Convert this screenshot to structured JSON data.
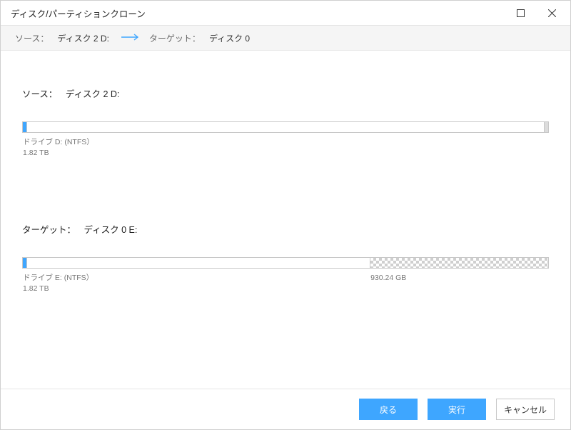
{
  "window": {
    "title": "ディスク/パーティションクローン"
  },
  "summary": {
    "source_label": "ソース：",
    "source_value": "ディスク 2 D:",
    "target_label": "ターゲット：",
    "target_value": "ディスク 0"
  },
  "source_section": {
    "label": "ソース：",
    "value": "ディスク 2 D:",
    "segments": [
      {
        "kind": "used",
        "width_pct": 0.8
      },
      {
        "kind": "free-white",
        "width_pct": 98.4
      },
      {
        "kind": "tail-gray",
        "width_pct": 0.8
      }
    ],
    "labels": [
      {
        "width_pct": 100,
        "line1": "ドライブ D: (NTFS）",
        "line2": "1.82 TB"
      }
    ]
  },
  "target_section": {
    "label": "ターゲット：",
    "value": "ディスク 0 E:",
    "segments": [
      {
        "kind": "used",
        "width_pct": 0.8
      },
      {
        "kind": "free-white",
        "width_pct": 65.2
      },
      {
        "kind": "unalloc",
        "width_pct": 34.0
      }
    ],
    "labels": [
      {
        "width_pct": 66,
        "line1": "ドライブ E: (NTFS）",
        "line2": "1.82 TB"
      },
      {
        "width_pct": 34,
        "line1": "",
        "line2": "930.24 GB"
      }
    ]
  },
  "footer": {
    "back": "戻る",
    "execute": "実行",
    "cancel": "キャンセル"
  }
}
